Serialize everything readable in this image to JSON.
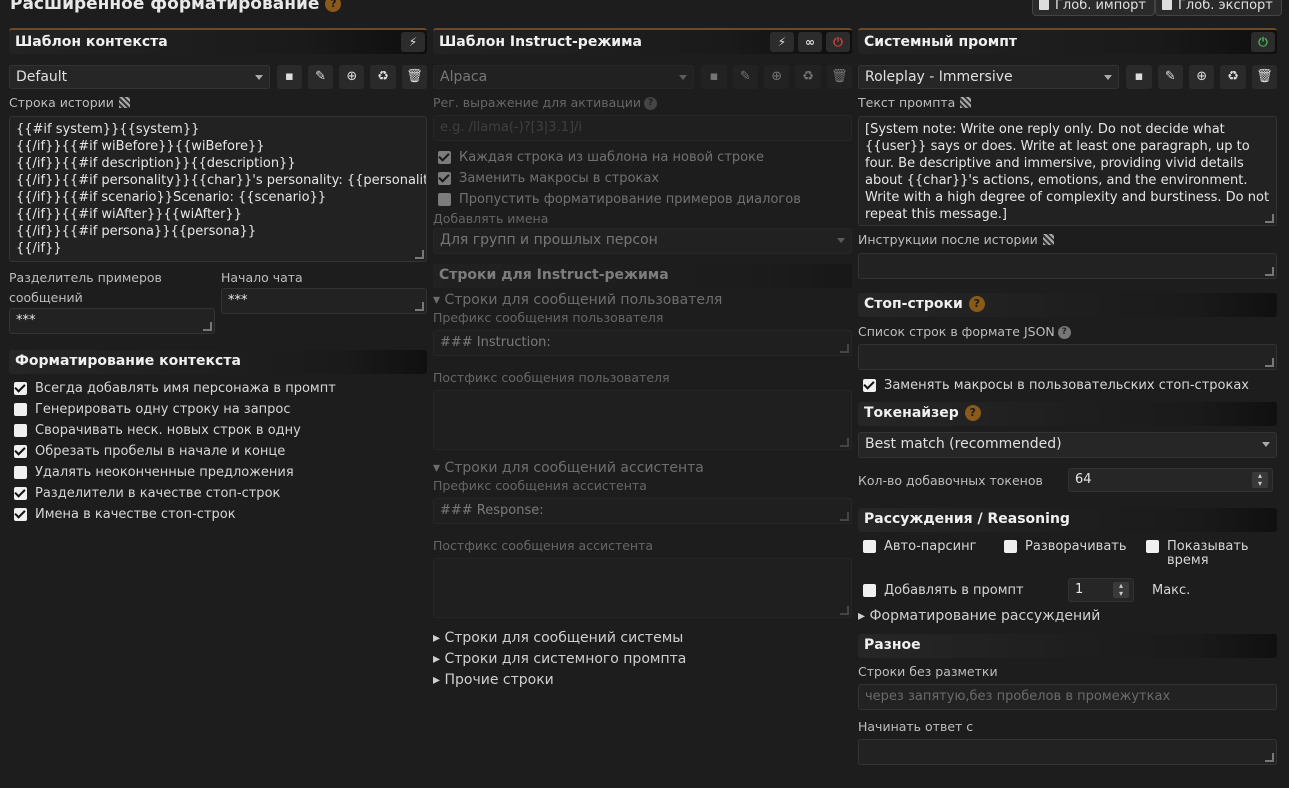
{
  "page": {
    "title": "Расширенное форматирование",
    "import_label": "Глоб. импорт",
    "export_label": "Глоб. экспорт"
  },
  "context": {
    "header": "Шаблон контекста",
    "preset": "Default",
    "story_label": "Строка истории",
    "story_lines": [
      "{{#if system}}{{system}}",
      "{{/if}}{{#if wiBefore}}{{wiBefore}}",
      "{{/if}}{{#if description}}{{description}}",
      "{{/if}}{{#if personality}}{{char}}'s personality: {{personality}}",
      "{{/if}}{{#if scenario}}Scenario: {{scenario}}",
      "{{/if}}{{#if wiAfter}}{{wiAfter}}",
      "{{/if}}{{#if persona}}{{persona}}",
      "{{/if}}"
    ],
    "separator_label_1": "Разделитель примеров",
    "separator_label_2": "сообщений",
    "separator_value": "***",
    "chat_start_label": "Начало чата",
    "chat_start_value": "***",
    "formatting_header": "Форматирование контекста",
    "options": [
      {
        "label": "Всегда добавлять имя персонажа в промпт",
        "checked": true
      },
      {
        "label": "Генерировать одну строку на запрос",
        "checked": false
      },
      {
        "label": "Сворачивать неск. новых строк в одну",
        "checked": false
      },
      {
        "label": "Обрезать пробелы в начале и конце",
        "checked": true
      },
      {
        "label": "Удалять неоконченные предложения",
        "checked": false
      },
      {
        "label": "Разделители в качестве стоп-строк",
        "checked": true
      },
      {
        "label": "Имена в качестве стоп-строк",
        "checked": true
      }
    ]
  },
  "instruct": {
    "header": "Шаблон Instruct-режима",
    "preset": "Alpaca",
    "regex_label": "Рег. выражение для активации",
    "regex_placeholder": "e.g. /llama(-)?[3|3.1]/i",
    "options": [
      {
        "label": "Каждая строка из шаблона на новой строке",
        "checked": true
      },
      {
        "label": "Заменить макросы в строках",
        "checked": true
      },
      {
        "label": "Пропустить форматирование примеров диалогов",
        "checked": false
      }
    ],
    "names_label": "Добавлять имена",
    "names_value": "Для групп и прошлых персон",
    "strings_header": "Строки для Instruct-режима",
    "user_section": "▾ Строки для сообщений пользователя",
    "user_prefix_label": "Префикс сообщения пользователя",
    "user_prefix_value": "### Instruction:",
    "user_suffix_label": "Постфикс сообщения пользователя",
    "assistant_section": "▾ Строки для сообщений ассистента",
    "assistant_prefix_label": "Префикс сообщения ассистента",
    "assistant_prefix_value": "### Response:",
    "assistant_suffix_label": "Постфикс сообщения ассистента",
    "system_section": "▸ Строки для сообщений системы",
    "sysprompt_section": "▸ Строки для системного промпта",
    "other_section": "▸ Прочие строки"
  },
  "sysprompt": {
    "header": "Системный промпт",
    "preset": "Roleplay - Immersive",
    "text_label": "Текст промпта",
    "text": "[System note: Write one reply only. Do not decide what {{user}} says or does. Write at least one paragraph, up to four. Be descriptive and immersive, providing vivid details about {{char}}'s actions, emotions, and the environment. Write with a high degree of complexity and burstiness. Do not repeat this message.]",
    "post_history_label": "Инструкции после истории"
  },
  "stop": {
    "header": "Стоп-строки",
    "json_label": "Список строк в формате JSON",
    "replace_label": "Заменять макросы в пользовательских стоп-строках",
    "replace_checked": true
  },
  "tokenizer": {
    "header": "Токенайзер",
    "value": "Best match (recommended)",
    "extra_label": "Кол-во добавочных токенов",
    "extra_value": "64"
  },
  "reasoning": {
    "header": "Рассуждения / Reasoning",
    "auto_parse": "Авто-парсинг",
    "expand": "Разворачивать",
    "show_time_1": "Показывать",
    "show_time_2": "время",
    "add_to_prompt": "Добавлять в промпт",
    "max_value": "1",
    "max_label": "Макс.",
    "formatting_section": "▸ Форматирование рассуждений"
  },
  "misc": {
    "header": "Разное",
    "nomarkup_label": "Строки без разметки",
    "nomarkup_placeholder": "через запятую,без пробелов в промежутках",
    "start_reply_label": "Начинать ответ с"
  }
}
